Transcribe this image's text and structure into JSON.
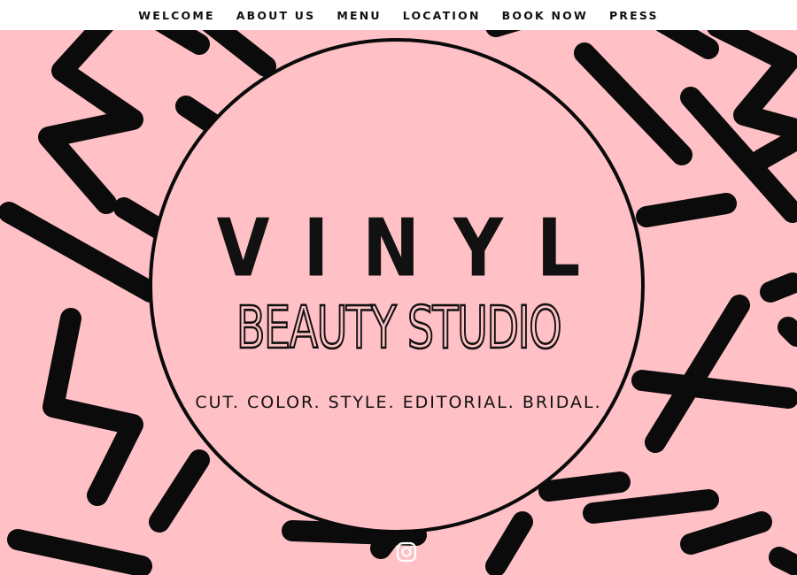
{
  "nav": {
    "items": [
      {
        "label": "WELCOME"
      },
      {
        "label": "ABOUT US"
      },
      {
        "label": "MENU"
      },
      {
        "label": "LOCATION"
      },
      {
        "label": "BOOK NOW"
      },
      {
        "label": "PRESS"
      }
    ]
  },
  "hero": {
    "title": "VINYL",
    "subtitle": "BEAUTY STUDIO",
    "tagline": "CUT. COLOR. STYLE. EDITORIAL. BRIDAL."
  },
  "social": {
    "icon": "instagram-icon"
  },
  "colors": {
    "background": "#ffc1c6",
    "ink": "#111111",
    "nav_bg": "#ffffff"
  }
}
